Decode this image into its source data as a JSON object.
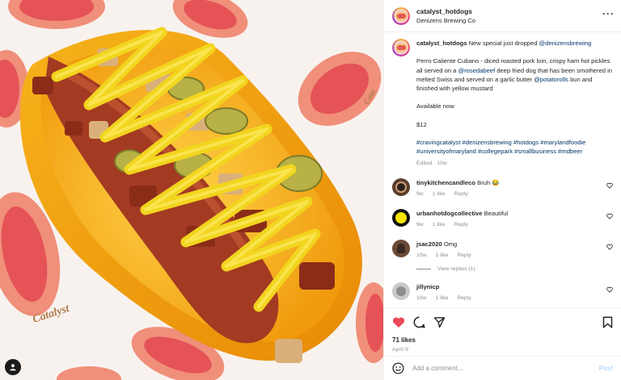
{
  "header": {
    "username": "catalyst_hotdogs",
    "location": "Denizens Brewing Co"
  },
  "caption": {
    "username": "catalyst_hotdogs",
    "lines": [
      [
        "New special just dropped ",
        "@denizensbrewing"
      ],
      [
        "Perro Caliente Cubano - diced roasted pork loin, crispy ham hot pickles all served on a ",
        "@rosedabeef",
        " deep fried dog that has been smothered in melted Swiss and served on a garlic butter ",
        "@potatorolls",
        " bun and finished with yellow mustard"
      ],
      [
        "Available now"
      ],
      [
        "$12"
      ],
      [
        "#cravingcatalyst #denizensbrewing #hotdogs #marylandfoodie #universityofmaryland #collegepark #smallbusiness #mdbeer"
      ]
    ],
    "edited": "Edited · 10w"
  },
  "comments": [
    {
      "username": "tinykitchencandleco",
      "text": "Bruh 😂",
      "time": "9w",
      "likes": "1 like",
      "reply": "Reply"
    },
    {
      "username": "urbanhotdogcollective",
      "text": "Beautiful",
      "time": "9w",
      "likes": "1 like",
      "reply": "Reply"
    },
    {
      "username": "jsac2020",
      "text": "Omg",
      "time": "10w",
      "likes": "1 like",
      "reply": "Reply",
      "view_replies": "View replies (1)"
    },
    {
      "username": "jillynicp",
      "text": "",
      "time": "10w",
      "likes": "1 like",
      "reply": "Reply"
    }
  ],
  "actions": {
    "likes": "71 likes",
    "date": "April 9"
  },
  "add_comment": {
    "placeholder": "Add a comment...",
    "post_label": "Post"
  },
  "colors": {
    "like_red": "#ed4956",
    "link_blue": "#00376b",
    "muted": "#8e8e8e"
  }
}
